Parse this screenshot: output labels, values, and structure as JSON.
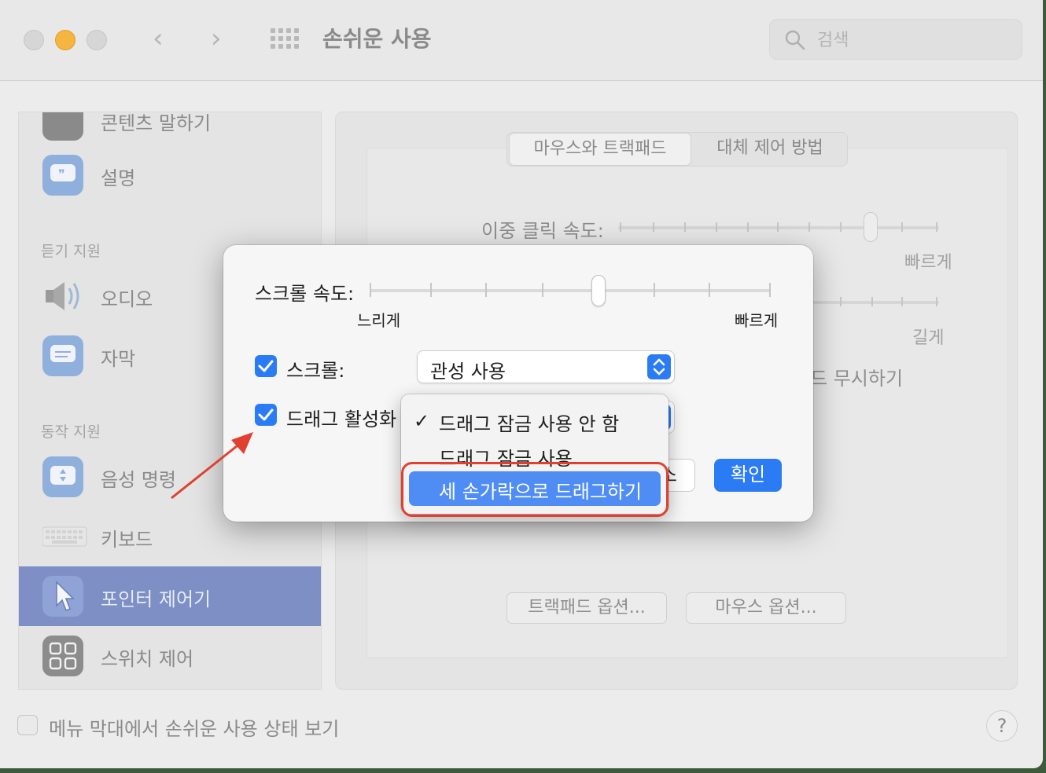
{
  "window": {
    "title": "손쉬운 사용",
    "search_placeholder": "검색"
  },
  "sidebar": {
    "partial_item": "콘텐츠 말하기",
    "items_top": [
      {
        "label": "설명"
      }
    ],
    "section_hearing": "듣기 지원",
    "items_hearing": [
      {
        "label": "오디오"
      },
      {
        "label": "자막"
      }
    ],
    "section_motor": "동작 지원",
    "items_motor": [
      {
        "label": "음성 명령"
      },
      {
        "label": "키보드"
      },
      {
        "label": "포인터 제어기"
      },
      {
        "label": "스위치 제어"
      }
    ]
  },
  "main": {
    "tabs": [
      {
        "label": "마우스와 트랙패드"
      },
      {
        "label": "대체 제어 방법"
      }
    ],
    "double_click_label": "이중 클릭 속도:",
    "fast_label": "빠르게",
    "long_label": "길게",
    "ignore_label_partial": "드 무시하기",
    "trackpad_options": "트랙패드 옵션...",
    "mouse_options": "마우스 옵션..."
  },
  "footer": {
    "menubar_status_label": "메뉴 막대에서 손쉬운 사용 상태 보기",
    "help": "?"
  },
  "sheet": {
    "scroll_speed_label": "스크롤 속도:",
    "slow_label": "느리게",
    "fast_label": "빠르게",
    "scroll_checkbox_label": "스크롤:",
    "scroll_popup_value": "관성 사용",
    "drag_checkbox_label": "드래그 활성화",
    "cancel_partial": "소",
    "ok": "확인"
  },
  "drag_menu": {
    "options": [
      "드래그 잠금 사용 안 함",
      "드래그 잠금 사용",
      "세 손가락으로 드래그하기"
    ],
    "checked_option": "드래그 잠금 사용 안 함",
    "highlighted_option": "세 손가락으로 드래그하기"
  },
  "colors": {
    "accent": "#2b7cf4",
    "menu_highlight": "#4f8df5",
    "annotation": "#e0412f",
    "sidebar_selection": "#7d8fc4"
  }
}
